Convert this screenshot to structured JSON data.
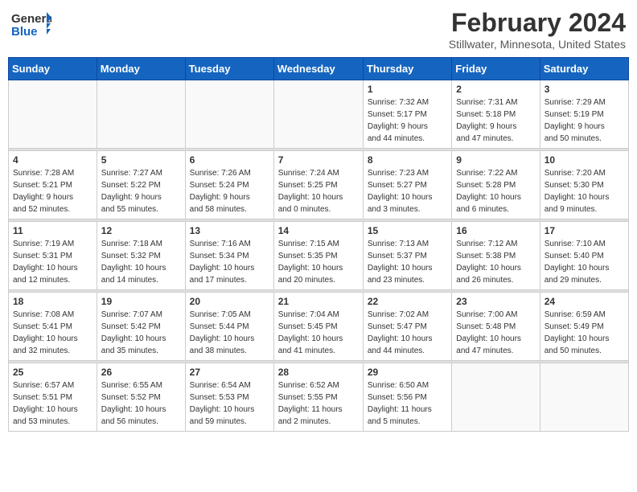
{
  "logo": {
    "line1": "General",
    "line2": "Blue"
  },
  "title": "February 2024",
  "subtitle": "Stillwater, Minnesota, United States",
  "weekdays": [
    "Sunday",
    "Monday",
    "Tuesday",
    "Wednesday",
    "Thursday",
    "Friday",
    "Saturday"
  ],
  "weeks": [
    [
      {
        "day": "",
        "info": ""
      },
      {
        "day": "",
        "info": ""
      },
      {
        "day": "",
        "info": ""
      },
      {
        "day": "",
        "info": ""
      },
      {
        "day": "1",
        "info": "Sunrise: 7:32 AM\nSunset: 5:17 PM\nDaylight: 9 hours\nand 44 minutes."
      },
      {
        "day": "2",
        "info": "Sunrise: 7:31 AM\nSunset: 5:18 PM\nDaylight: 9 hours\nand 47 minutes."
      },
      {
        "day": "3",
        "info": "Sunrise: 7:29 AM\nSunset: 5:19 PM\nDaylight: 9 hours\nand 50 minutes."
      }
    ],
    [
      {
        "day": "4",
        "info": "Sunrise: 7:28 AM\nSunset: 5:21 PM\nDaylight: 9 hours\nand 52 minutes."
      },
      {
        "day": "5",
        "info": "Sunrise: 7:27 AM\nSunset: 5:22 PM\nDaylight: 9 hours\nand 55 minutes."
      },
      {
        "day": "6",
        "info": "Sunrise: 7:26 AM\nSunset: 5:24 PM\nDaylight: 9 hours\nand 58 minutes."
      },
      {
        "day": "7",
        "info": "Sunrise: 7:24 AM\nSunset: 5:25 PM\nDaylight: 10 hours\nand 0 minutes."
      },
      {
        "day": "8",
        "info": "Sunrise: 7:23 AM\nSunset: 5:27 PM\nDaylight: 10 hours\nand 3 minutes."
      },
      {
        "day": "9",
        "info": "Sunrise: 7:22 AM\nSunset: 5:28 PM\nDaylight: 10 hours\nand 6 minutes."
      },
      {
        "day": "10",
        "info": "Sunrise: 7:20 AM\nSunset: 5:30 PM\nDaylight: 10 hours\nand 9 minutes."
      }
    ],
    [
      {
        "day": "11",
        "info": "Sunrise: 7:19 AM\nSunset: 5:31 PM\nDaylight: 10 hours\nand 12 minutes."
      },
      {
        "day": "12",
        "info": "Sunrise: 7:18 AM\nSunset: 5:32 PM\nDaylight: 10 hours\nand 14 minutes."
      },
      {
        "day": "13",
        "info": "Sunrise: 7:16 AM\nSunset: 5:34 PM\nDaylight: 10 hours\nand 17 minutes."
      },
      {
        "day": "14",
        "info": "Sunrise: 7:15 AM\nSunset: 5:35 PM\nDaylight: 10 hours\nand 20 minutes."
      },
      {
        "day": "15",
        "info": "Sunrise: 7:13 AM\nSunset: 5:37 PM\nDaylight: 10 hours\nand 23 minutes."
      },
      {
        "day": "16",
        "info": "Sunrise: 7:12 AM\nSunset: 5:38 PM\nDaylight: 10 hours\nand 26 minutes."
      },
      {
        "day": "17",
        "info": "Sunrise: 7:10 AM\nSunset: 5:40 PM\nDaylight: 10 hours\nand 29 minutes."
      }
    ],
    [
      {
        "day": "18",
        "info": "Sunrise: 7:08 AM\nSunset: 5:41 PM\nDaylight: 10 hours\nand 32 minutes."
      },
      {
        "day": "19",
        "info": "Sunrise: 7:07 AM\nSunset: 5:42 PM\nDaylight: 10 hours\nand 35 minutes."
      },
      {
        "day": "20",
        "info": "Sunrise: 7:05 AM\nSunset: 5:44 PM\nDaylight: 10 hours\nand 38 minutes."
      },
      {
        "day": "21",
        "info": "Sunrise: 7:04 AM\nSunset: 5:45 PM\nDaylight: 10 hours\nand 41 minutes."
      },
      {
        "day": "22",
        "info": "Sunrise: 7:02 AM\nSunset: 5:47 PM\nDaylight: 10 hours\nand 44 minutes."
      },
      {
        "day": "23",
        "info": "Sunrise: 7:00 AM\nSunset: 5:48 PM\nDaylight: 10 hours\nand 47 minutes."
      },
      {
        "day": "24",
        "info": "Sunrise: 6:59 AM\nSunset: 5:49 PM\nDaylight: 10 hours\nand 50 minutes."
      }
    ],
    [
      {
        "day": "25",
        "info": "Sunrise: 6:57 AM\nSunset: 5:51 PM\nDaylight: 10 hours\nand 53 minutes."
      },
      {
        "day": "26",
        "info": "Sunrise: 6:55 AM\nSunset: 5:52 PM\nDaylight: 10 hours\nand 56 minutes."
      },
      {
        "day": "27",
        "info": "Sunrise: 6:54 AM\nSunset: 5:53 PM\nDaylight: 10 hours\nand 59 minutes."
      },
      {
        "day": "28",
        "info": "Sunrise: 6:52 AM\nSunset: 5:55 PM\nDaylight: 11 hours\nand 2 minutes."
      },
      {
        "day": "29",
        "info": "Sunrise: 6:50 AM\nSunset: 5:56 PM\nDaylight: 11 hours\nand 5 minutes."
      },
      {
        "day": "",
        "info": ""
      },
      {
        "day": "",
        "info": ""
      }
    ]
  ]
}
